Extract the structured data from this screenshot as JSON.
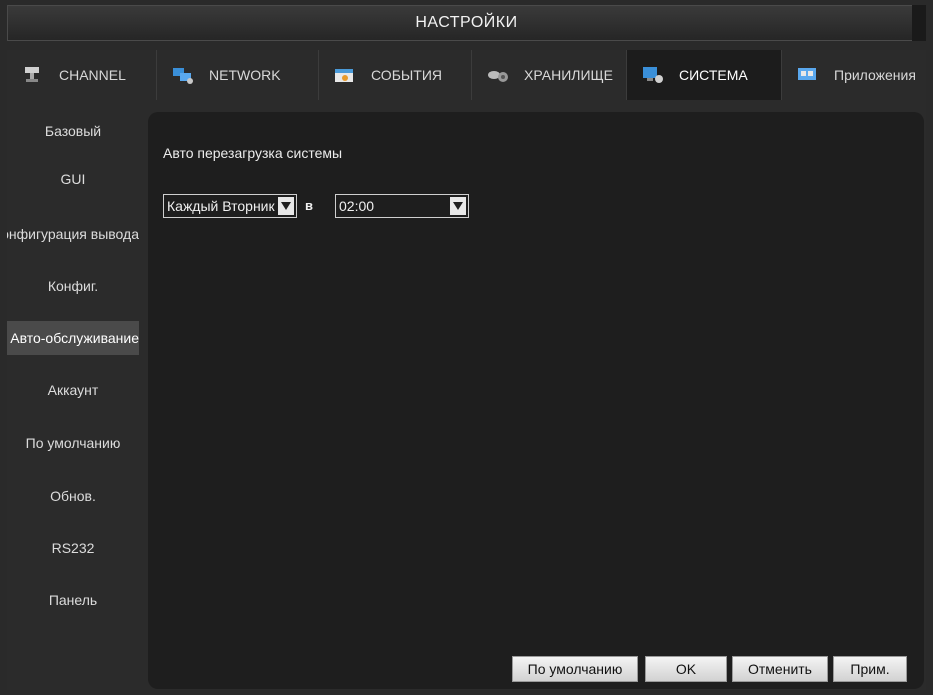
{
  "window": {
    "title": "НАСТРОЙКИ"
  },
  "tabs": [
    {
      "label": "CHANNEL",
      "icon": "camera-icon"
    },
    {
      "label": "NETWORK",
      "icon": "network-icon"
    },
    {
      "label": "СОБЫТИЯ",
      "icon": "events-icon"
    },
    {
      "label": "ХРАНИЛИЩЕ",
      "icon": "storage-icon"
    },
    {
      "label": "СИСТЕМА",
      "icon": "system-icon",
      "active": true
    },
    {
      "label": "Приложения",
      "icon": "apps-icon"
    }
  ],
  "sidebar": {
    "items": [
      {
        "label": "Базовый"
      },
      {
        "label": "GUI"
      },
      {
        "label": "Конфигурация вывода"
      },
      {
        "label": "Конфиг."
      },
      {
        "label": "Авто-обслуживание",
        "active": true
      },
      {
        "label": "Аккаунт"
      },
      {
        "label": "По умолчанию"
      },
      {
        "label": "Обнов."
      },
      {
        "label": "RS232"
      },
      {
        "label": "Панель"
      }
    ]
  },
  "main": {
    "heading": "Авто перезагрузка системы",
    "day_select": {
      "value": "Каждый Вторник"
    },
    "conjunction": "в",
    "time_select": {
      "value": "02:00"
    }
  },
  "footer": {
    "default_label": "По умолчанию",
    "ok_label": "OK",
    "cancel_label": "Отменить",
    "apply_label": "Прим."
  },
  "colors": {
    "background": "#2b2b2b",
    "panel": "#1e1e1e",
    "active_item": "#4a4a4a"
  }
}
